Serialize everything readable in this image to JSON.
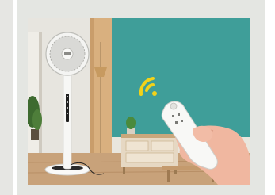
{
  "image": {
    "kind": "product-photo",
    "subject": "standing-fan-with-remote-control",
    "alt": "",
    "colors": {
      "teal_wall": "#3f9e99",
      "floor_wood": "#c8a27a",
      "frame_gray": "#e4e6e2",
      "signal_yellow": "#f2d21a",
      "fan_white": "#f4f4f2"
    }
  }
}
